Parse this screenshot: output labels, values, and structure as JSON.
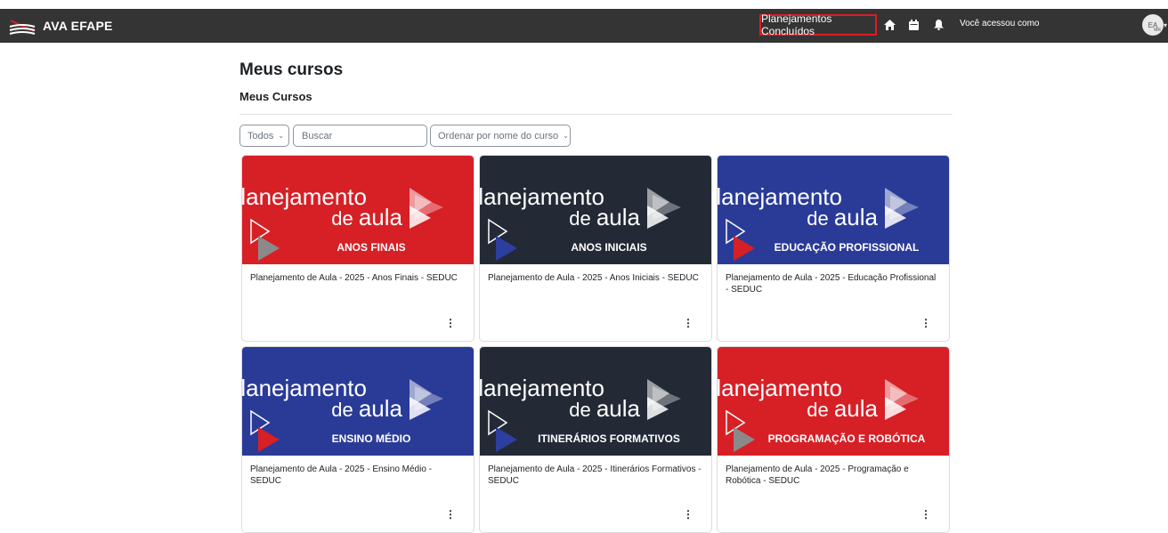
{
  "navbar": {
    "brand": "AVA EFAPE",
    "highlight_link": "Planejamentos Concluídos",
    "home_icon": "home-icon",
    "calendar_icon": "calendar-icon",
    "bell_icon": "bell-icon",
    "access_text": "Você acessou como",
    "avatar_initials": "EA",
    "avatar_sub": "MR",
    "background": "#343434",
    "highlight_border": "#e01b24"
  },
  "page": {
    "title": "Meus cursos",
    "section": "Meus Cursos"
  },
  "filters": {
    "grouping": "Todos",
    "search_placeholder": "Buscar",
    "sort": "Ordenar por nome do curso"
  },
  "banner": {
    "word1": "planejamento",
    "word2_prefix": "de",
    "word2_main": "aula"
  },
  "courses": [
    {
      "banner_label": "ANOS FINAIS",
      "banner_color": "#d71f26",
      "accent_color": "#8a8a8a",
      "title": "Planejamento de Aula - 2025 - Anos Finais - SEDUC"
    },
    {
      "banner_label": "ANOS INICIAIS",
      "banner_color": "#232a36",
      "accent_color": "#2d3ea0",
      "title": "Planejamento de Aula - 2025 - Anos Iniciais - SEDUC"
    },
    {
      "banner_label": "EDUCAÇÃO PROFISSIONAL",
      "banner_color": "#2a3b97",
      "accent_color": "#d71f26",
      "title": "Planejamento de Aula - 2025 - Educação Profissional - SEDUC"
    },
    {
      "banner_label": "ENSINO MÉDIO",
      "banner_color": "#2a3b97",
      "accent_color": "#d71f26",
      "title": "Planejamento de Aula - 2025 - Ensino Médio - SEDUC"
    },
    {
      "banner_label": "ITINERÁRIOS FORMATIVOS",
      "banner_color": "#232a36",
      "accent_color": "#2d3ea0",
      "title": "Planejamento de Aula - 2025 - Itinerários Formativos  - SEDUC"
    },
    {
      "banner_label": "PROGRAMAÇÃO E ROBÓTICA",
      "banner_color": "#d71f26",
      "accent_color": "#8a8a8a",
      "title": "Planejamento de Aula - 2025 - Programação e Robótica - SEDUC"
    }
  ]
}
